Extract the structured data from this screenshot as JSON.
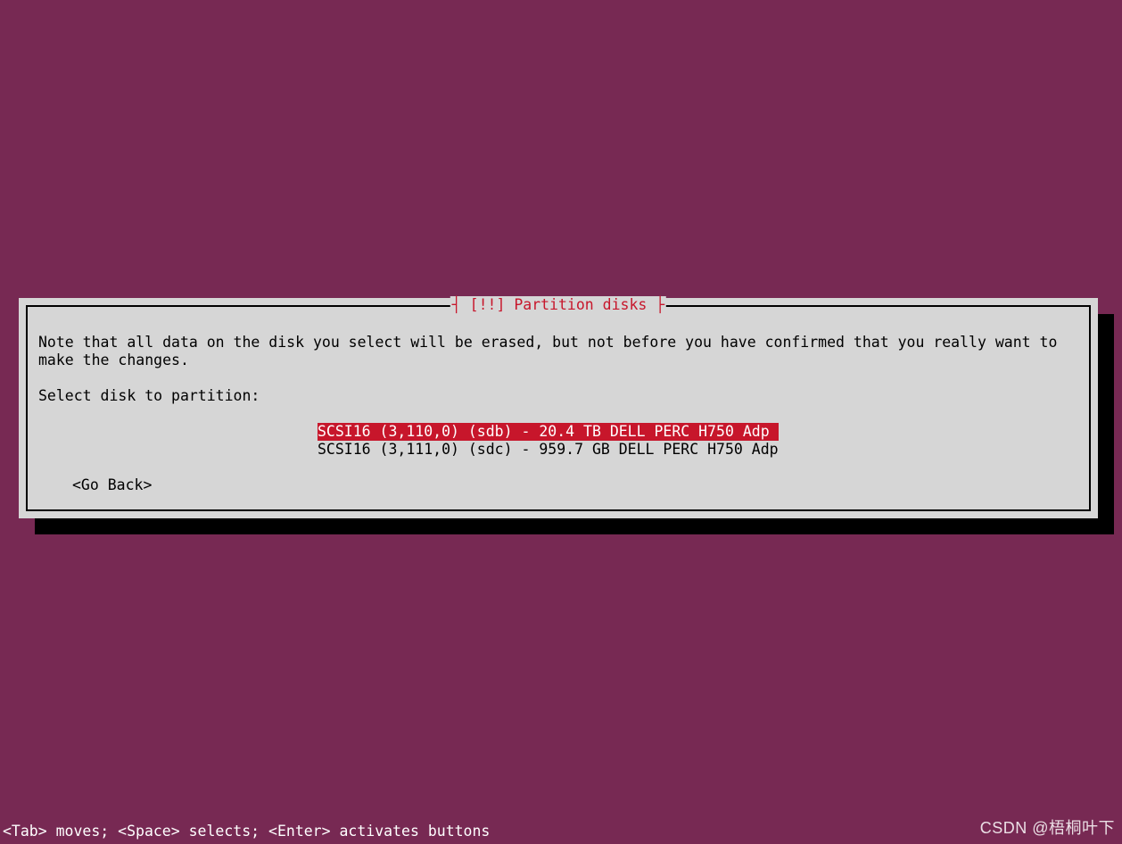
{
  "dialog": {
    "title": "┤ [!!] Partition disks ├",
    "note": "Note that all data on the disk you select will be erased, but not before you have confirmed that you really want to make the changes.",
    "prompt": "Select disk to partition:",
    "disks": [
      {
        "label": "SCSI16 (3,110,0) (sdb) - 20.4 TB DELL PERC H750 Adp ",
        "selected": true
      },
      {
        "label": "SCSI16 (3,111,0) (sdc) - 959.7 GB DELL PERC H750 Adp",
        "selected": false
      }
    ],
    "go_back": "<Go Back>"
  },
  "footer": "<Tab> moves; <Space> selects; <Enter> activates buttons",
  "watermark": "CSDN @梧桐叶下"
}
